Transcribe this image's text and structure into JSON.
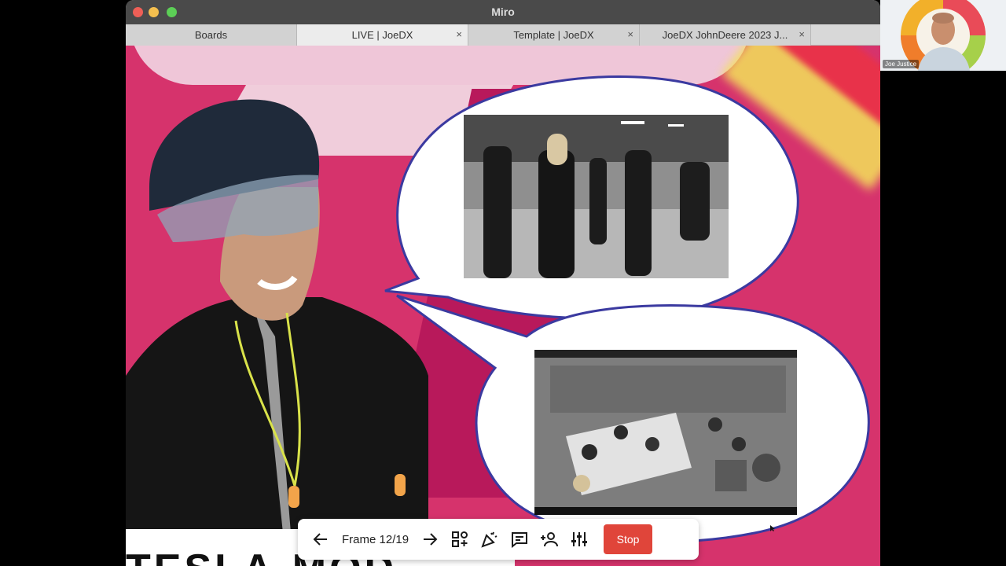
{
  "window": {
    "title": "Miro"
  },
  "tabs": [
    {
      "label": "Boards",
      "active": false,
      "closable": false
    },
    {
      "label": "LIVE | JoeDX",
      "active": true,
      "closable": true
    },
    {
      "label": "Template | JoeDX",
      "active": false,
      "closable": true
    },
    {
      "label": "JoeDX JohnDeere 2023 J...",
      "active": false,
      "closable": true
    }
  ],
  "tab_close_glyph": "×",
  "board": {
    "title_text": "TESLA-MOD",
    "colors": {
      "background": "#d6336c",
      "accent_yellow": "#f3e35a",
      "bubble_border": "#3b3aa0"
    }
  },
  "toolbar": {
    "prev_icon": "arrow-left-icon",
    "frame_label": "Frame 12/19",
    "next_icon": "arrow-right-icon",
    "stop_label": "Stop",
    "stop_color": "#e0453a"
  },
  "webcam": {
    "name": "Joe Justice"
  }
}
